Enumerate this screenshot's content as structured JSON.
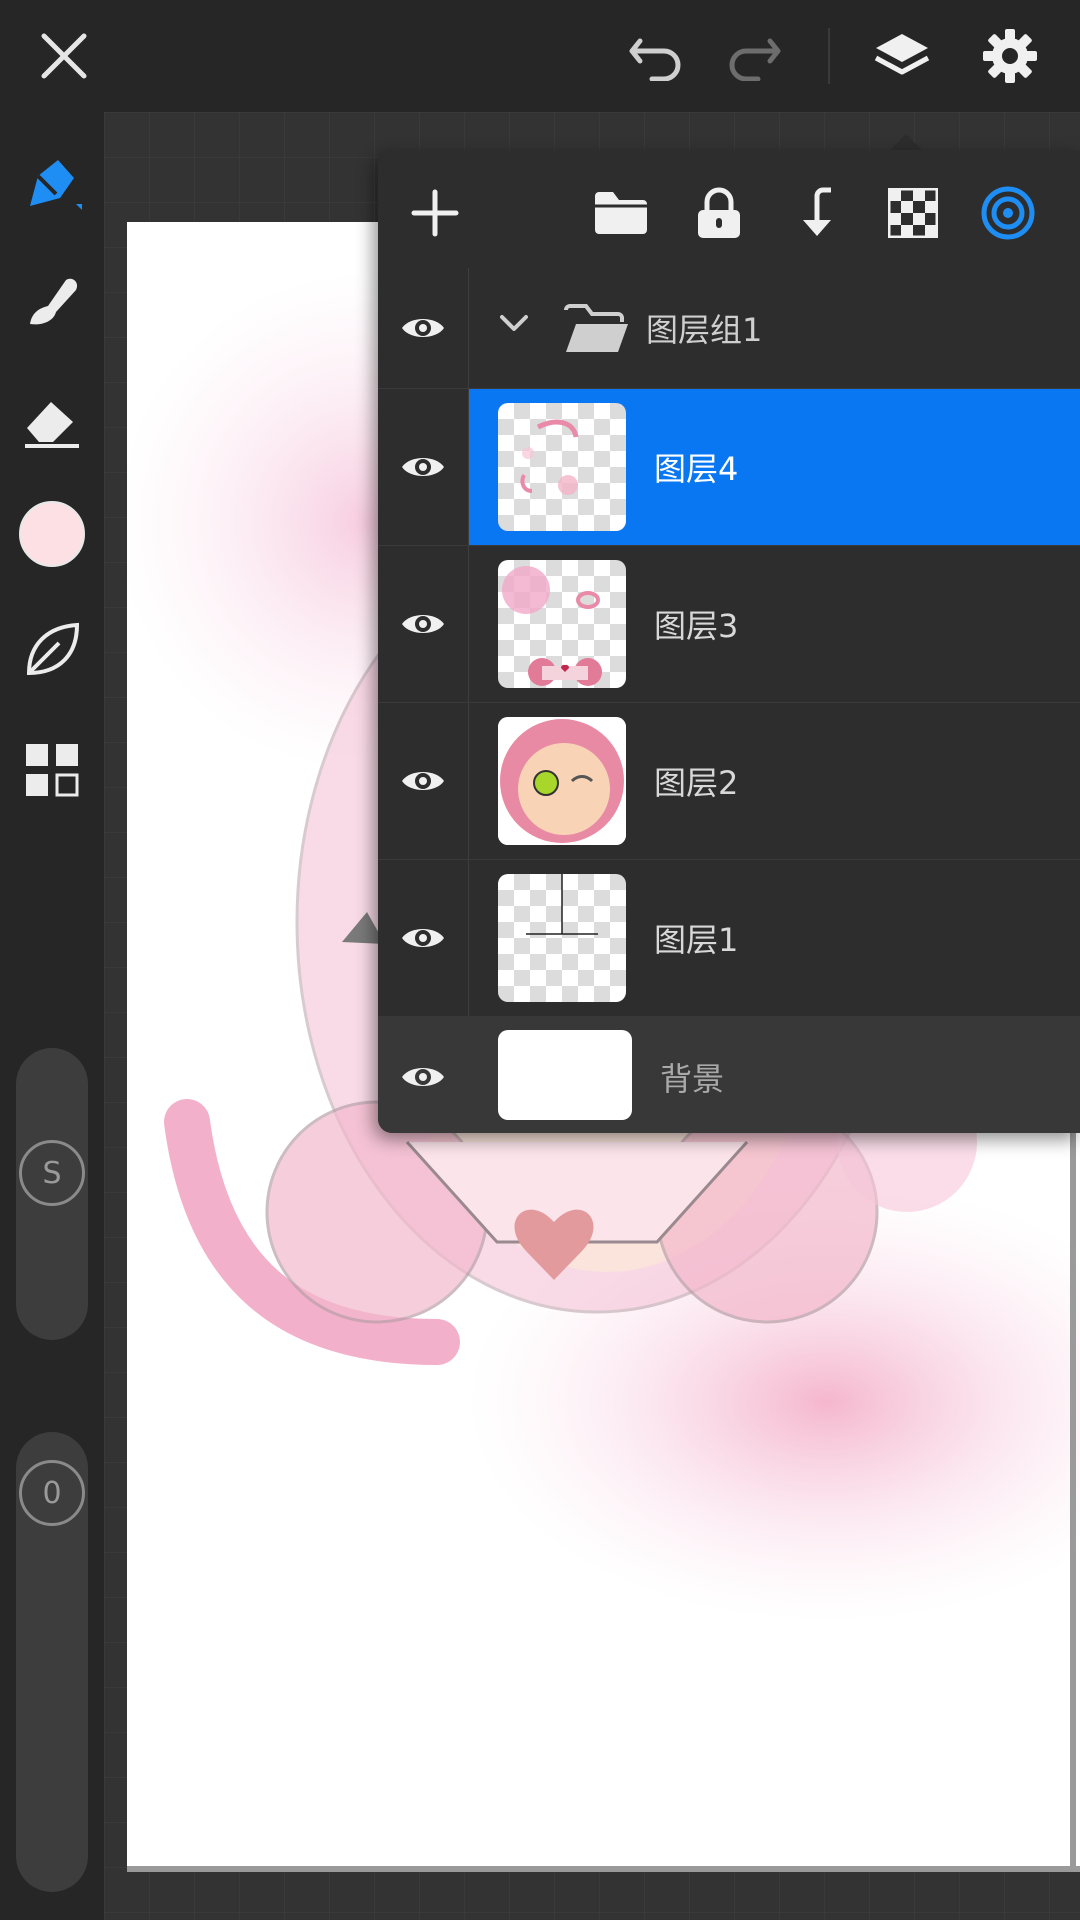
{
  "colors": {
    "accent": "#0a77f2",
    "brush_color": "#fde0e4"
  },
  "topbar": {
    "close_icon": "close-icon",
    "undo_icon": "undo-icon",
    "redo_icon": "redo-icon",
    "layers_icon": "layers-icon",
    "settings_icon": "gear-icon"
  },
  "left_toolbar": {
    "tools": [
      "pen-icon",
      "smudge-icon",
      "eraser-icon",
      "color-swatch",
      "leaf-icon",
      "grid-icon"
    ],
    "size_slider_label": "S",
    "opacity_slider_label": "0"
  },
  "layers_panel": {
    "toolbar": [
      "add-icon",
      "folder-icon",
      "lock-icon",
      "merge-down-icon",
      "transparency-icon",
      "target-icon"
    ],
    "group": {
      "name": "图层组1"
    },
    "layers": [
      {
        "name": "图层4",
        "selected": true,
        "visible": true
      },
      {
        "name": "图层3",
        "selected": false,
        "visible": true
      },
      {
        "name": "图层2",
        "selected": false,
        "visible": true
      },
      {
        "name": "图层1",
        "selected": false,
        "visible": true
      }
    ],
    "background": {
      "name": "背景",
      "visible": true
    }
  }
}
